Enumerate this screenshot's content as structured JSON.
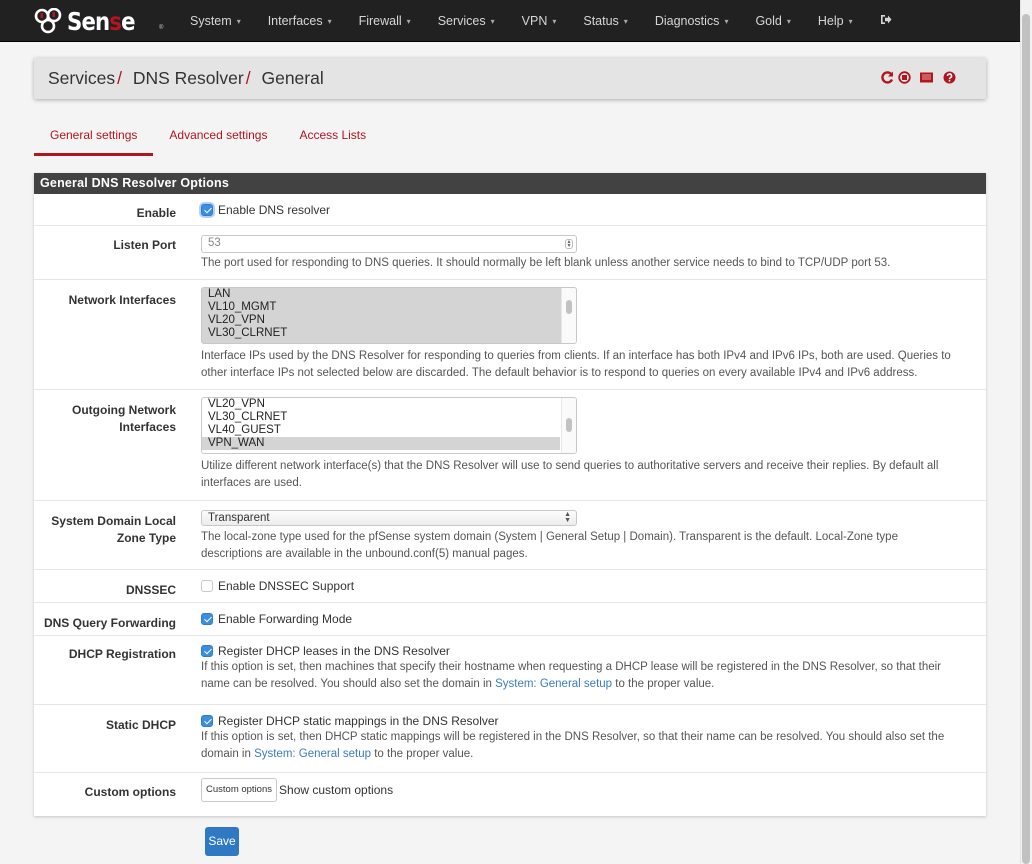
{
  "nav": {
    "brand": {
      "prefix": "Sen",
      "accent": "s",
      "suffix": "e",
      "mark": "®"
    },
    "items": [
      {
        "label": "System"
      },
      {
        "label": "Interfaces"
      },
      {
        "label": "Firewall"
      },
      {
        "label": "Services"
      },
      {
        "label": "VPN"
      },
      {
        "label": "Status"
      },
      {
        "label": "Diagnostics"
      },
      {
        "label": "Gold"
      },
      {
        "label": "Help"
      }
    ],
    "logout_icon": "sign-out-icon"
  },
  "breadcrumb": {
    "items": [
      "Services",
      "DNS Resolver",
      "General"
    ],
    "separator": "/",
    "icons": [
      "restart-icon",
      "stop-icon",
      "log-icon",
      "help-icon"
    ]
  },
  "tabs": [
    {
      "label": "General settings",
      "active": true
    },
    {
      "label": "Advanced settings",
      "active": false
    },
    {
      "label": "Access Lists",
      "active": false
    }
  ],
  "panel": {
    "title": "General DNS Resolver Options",
    "enable": {
      "label": "Enable",
      "checkbox_label": "Enable DNS resolver",
      "checked": true
    },
    "listen_port": {
      "label": "Listen Port",
      "value": "53",
      "help": "The port used for responding to DNS queries. It should normally be left blank unless another service needs to bind to TCP/UDP port 53."
    },
    "network_interfaces": {
      "label": "Network Interfaces",
      "options": [
        {
          "label": "LAN",
          "selected": true
        },
        {
          "label": "VL10_MGMT",
          "selected": true
        },
        {
          "label": "VL20_VPN",
          "selected": true
        },
        {
          "label": "VL30_CLRNET",
          "selected": true
        }
      ],
      "help_line1": "Interface IPs used by the DNS Resolver for responding to queries from clients. If an interface has both IPv4 and IPv6 IPs, both are used. Queries to",
      "help_line2": "other interface IPs not selected below are discarded. The default behavior is to respond to queries on every available IPv4 and IPv6 address."
    },
    "outgoing_interfaces": {
      "label_line1": "Outgoing Network",
      "label_line2": "Interfaces",
      "options": [
        {
          "label": "VL20_VPN",
          "selected": false
        },
        {
          "label": "VL30_CLRNET",
          "selected": false
        },
        {
          "label": "VL40_GUEST",
          "selected": false
        },
        {
          "label": "VPN_WAN",
          "selected": true
        }
      ],
      "help_line1": "Utilize different network interface(s) that the DNS Resolver will use to send queries to authoritative servers and receive their replies. By default all",
      "help_line2": "interfaces are used."
    },
    "zone_type": {
      "label_line1": "System Domain Local",
      "label_line2": "Zone Type",
      "selected": "Transparent",
      "help_line1": "The local-zone type used for the pfSense system domain (System | General Setup | Domain). Transparent is the default. Local-Zone type",
      "help_line2": "descriptions are available in the unbound.conf(5) manual pages."
    },
    "dnssec": {
      "label": "DNSSEC",
      "checkbox_label": "Enable DNSSEC Support",
      "checked": false
    },
    "forwarding": {
      "label": "DNS Query Forwarding",
      "checkbox_label": "Enable Forwarding Mode",
      "checked": true
    },
    "dhcp_registration": {
      "label": "DHCP Registration",
      "checkbox_label": "Register DHCP leases in the DNS Resolver",
      "checked": true,
      "help_line1": "If this option is set, then machines that specify their hostname when requesting a DHCP lease will be registered in the DNS Resolver, so that their",
      "help_line2_pre": "name can be resolved. You should also set the domain in ",
      "help_link": "System: General setup",
      "help_line2_post": " to the proper value."
    },
    "static_dhcp": {
      "label": "Static DHCP",
      "checkbox_label": "Register DHCP static mappings in the DNS Resolver",
      "checked": true,
      "help_line1": "If this option is set, then DHCP static mappings will be registered in the DNS Resolver, so that their name can be resolved. You should also set the",
      "help_line2_pre": "domain in ",
      "help_link": "System: General setup",
      "help_line2_post": " to the proper value."
    },
    "custom_options": {
      "label": "Custom options",
      "button_label": "Custom options",
      "show_label": "Show custom options"
    }
  },
  "save_label": "Save",
  "colors": {
    "accent": "#b0161f",
    "primary": "#2f78c4",
    "navbar": "#212121",
    "panel_heading": "#424242",
    "link": "#3a7cbf"
  }
}
